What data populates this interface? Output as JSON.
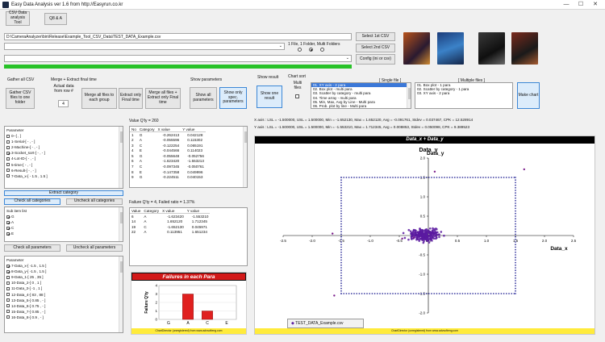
{
  "window": {
    "title": "Easy Data Analysis ver 1.6 from http://Easyrun.co.kr",
    "minimize": "—",
    "maximize": "☐",
    "close": "✕"
  },
  "top": {
    "csv_tool_btn": "CSV Data analysis Tool",
    "qa_btn": "Q8 & A",
    "path": "D:\\CameraAnalyzer\\bin\\Release\\Example_Tool_CSV_Data\\TEST_DATA_Example.csv",
    "select1": "Select 1st CSV",
    "select2": "Select 2nd CSV",
    "config": "Config (ini or csv)",
    "file_mode_label": "1 File, 1 Folder, Multi Folders"
  },
  "gather": {
    "heading": "Gather all CSV",
    "btn": "Gather CSV files to one folder",
    "merge_heading": "Merge + Extract final time",
    "actual_label": "Actual data from row #",
    "actual_value": "4",
    "merge_btn": "Merge all files to each group",
    "extract_btn": "Extract only Final time",
    "merge_extract_btn": "Merge all files + Extract only Final time"
  },
  "params_section": {
    "heading": "Show parameters",
    "show_all": "Show all parameters",
    "show_spec": "Show only spec. parameters",
    "show_result_heading": "Show result",
    "show_result_btn": "Show one result",
    "chart_sort": "Chart sort",
    "multi_files": "Multi files"
  },
  "single_file": {
    "label": "[ Single file ]",
    "items": [
      "01. XY axis - 2 para",
      "02. Box plot - multi para",
      "03. Scatter by category - multi para",
      "04. Time array - multi para",
      "05. Min, Max, Avg by Line - Multi para",
      "06. Prob. plot by line - Multi para"
    ]
  },
  "multiple_files": {
    "label": "[ Multiple files ]",
    "items": [
      "01. Box plot - 1 para",
      "02. Scatter by category - 1 para",
      "03. XY axis - 2 para"
    ]
  },
  "make_chart": "Make chart",
  "param_list": {
    "heading": "Parameter",
    "items": [
      {
        "label": "0--[ , ]",
        "checked": false
      },
      {
        "label": "1-Serial-[ - , - ]",
        "checked": false
      },
      {
        "label": "2-Machine-[ - , - ]",
        "checked": false
      },
      {
        "label": "3-Socket_sort-[ - , - ]",
        "checked": true
      },
      {
        "label": "4-Lot-ID-[ - , - ]",
        "checked": false
      },
      {
        "label": "5-time-[ - , - ]",
        "checked": false
      },
      {
        "label": "6-Result-[ - , - ]",
        "checked": false
      },
      {
        "label": "7-Data_x-[ - 1.5 , 1.5 ]",
        "checked": false
      }
    ]
  },
  "extract_category": "Extract category",
  "check_all_categories": "Check all categories",
  "uncheck_all_categories": "Uncheck all categories",
  "sub_items": {
    "heading": "Sub item list",
    "items": [
      {
        "label": "G",
        "checked": true
      },
      {
        "label": "A",
        "checked": true
      },
      {
        "label": "C",
        "checked": true
      },
      {
        "label": "E",
        "checked": true
      }
    ]
  },
  "check_all_parameters": "Check all parameters",
  "uncheck_all_parameters": "Uncheck all parameters",
  "param_list2": {
    "heading": "Parameter",
    "items": [
      {
        "label": "7-Data_x-[ -1.5 , 1.5 ]",
        "checked": true
      },
      {
        "label": "8-Data_y-[ -1.5 , 1.5 ]",
        "checked": true
      },
      {
        "label": "9-Data_1-[ 25 , 35 ]",
        "checked": false
      },
      {
        "label": "10-Data_2-[ 0 , 1 ]",
        "checked": false
      },
      {
        "label": "11-Data_3-[ -1 , 1 ]",
        "checked": false
      },
      {
        "label": "12-Data_4-[ 83 , 88 ]",
        "checked": false
      },
      {
        "label": "13-Data_5-[ 0.85 , - ]",
        "checked": false
      },
      {
        "label": "14-Data_6-[ 0.75 , - ]",
        "checked": false
      },
      {
        "label": "15-Data_7-[ 0.85 , - ]",
        "checked": false
      },
      {
        "label": "16-Data_8-[ 0.9 , - ]",
        "checked": false
      }
    ]
  },
  "value_table": {
    "heading": "Value Q'ty = 260",
    "columns": [
      "No",
      "Category",
      "X value",
      "Y value"
    ],
    "rows": [
      [
        "1",
        "G",
        "-0.262413",
        "0.042128"
      ],
      [
        "2",
        "A",
        "-0.055596",
        "0.115302"
      ],
      [
        "3",
        "C",
        "-0.122254",
        "0.065191"
      ],
      [
        "4",
        "E",
        "-0.044566",
        "0.114023"
      ],
      [
        "5",
        "G",
        "-0.055648",
        "-0.052756"
      ],
      [
        "6",
        "A",
        "-1.623420",
        "-1.553213"
      ],
      [
        "7",
        "C",
        "-0.097345",
        "-0.050761"
      ],
      [
        "8",
        "E",
        "-0.147358",
        "0.049996"
      ],
      [
        "9",
        "G",
        "-0.224511",
        "0.040153"
      ]
    ]
  },
  "failure_table": {
    "heading": "Failure Q'ty = 4, Failed ratio = 1.37%",
    "columns": [
      "Value",
      "Category",
      "X value",
      "Y value"
    ],
    "rows": [
      [
        "6",
        "A",
        "-1.623420",
        "-1.553210"
      ],
      [
        "14",
        "A",
        "1.652120",
        "1.712345"
      ],
      [
        "19",
        "C",
        "-1.652130",
        "0.045971"
      ],
      [
        "22",
        "A",
        "0.113951",
        "1.651234"
      ]
    ]
  },
  "failure_chart": {
    "title": "Failures in each Para",
    "ylabel": "Failure Q'ty",
    "credit": "ChartDirector (unregistered) from www.advsofteng.com"
  },
  "stats": {
    "x_line": "X axis : LSL = -1.500000, USL = 1.500000, Min = -1.652130, Max = 1.652120, Avg = -0.091761, Stdev = 0.037467, CPK = 12.528914",
    "y_line": "Y axis : LSL = -1.500000, USL = 1.500000, Min = -1.553210, Max = 1.712345, Avg = 0.008853, Stdev = 0.050098, CPK = 9.389523"
  },
  "xy_chart": {
    "banner": "Data_x + Data_y",
    "credit": "ChartDirector (unregistered) from www.advsofteng.com",
    "legend": "TEST_DATA_Example.csv"
  },
  "colors": {
    "accent": "#3c87d6",
    "progress": "#28c228",
    "bar": "#e0201f",
    "scatter_cluster": "#5a1aa0",
    "spec_box": "#3a3aa0"
  },
  "chart_data": [
    {
      "type": "bar",
      "title": "Failures in each Para",
      "ylabel": "Failure Q'ty",
      "categories": [
        "G",
        "A",
        "C",
        "E"
      ],
      "values": [
        0,
        3,
        1,
        0
      ],
      "ylim": [
        0,
        4
      ],
      "yticks": [
        "0",
        "1",
        "2",
        "3",
        "4"
      ]
    },
    {
      "type": "scatter",
      "title": "Data_y",
      "xlabel": "Data_x",
      "ylabel": "Data_y",
      "xlim": [
        -2.5,
        2.5
      ],
      "ylim": [
        -2.0,
        2.0
      ],
      "xticks": [
        "-2.5",
        "-2.0",
        "-1.5",
        "-1.0",
        "-0.5",
        "0.0",
        "0.5",
        "1.0",
        "1.5",
        "2.0",
        "2.5"
      ],
      "yticks": [
        "2.0",
        "1.5",
        "1.0",
        "0.5",
        "0.0",
        "-0.5",
        "-1.0",
        "-1.5",
        "-2.0"
      ],
      "spec_box": {
        "x": [
          -1.5,
          1.5
        ],
        "y": [
          -1.5,
          1.5
        ]
      },
      "outliers": [
        {
          "x": -1.62,
          "y": -1.55
        },
        {
          "x": 1.65,
          "y": 1.71
        },
        {
          "x": -1.65,
          "y": 0.05
        },
        {
          "x": 0.11,
          "y": 1.65
        },
        {
          "x": -0.25,
          "y": -0.05
        },
        {
          "x": -0.45,
          "y": -0.08
        }
      ],
      "cluster": {
        "center_x": -0.05,
        "center_y": 0.02,
        "spread_x": 0.13,
        "spread_y": 0.07,
        "count": 260
      }
    }
  ]
}
